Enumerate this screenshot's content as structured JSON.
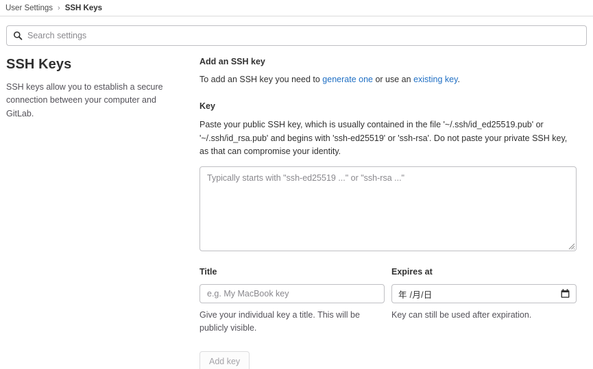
{
  "breadcrumb": {
    "parent": "User Settings",
    "separator": "›",
    "current": "SSH Keys"
  },
  "search": {
    "placeholder": "Search settings",
    "value": "",
    "icon": "search-icon"
  },
  "sidebar": {
    "title": "SSH Keys",
    "description": "SSH keys allow you to establish a secure connection between your computer and GitLab."
  },
  "main": {
    "section_title": "Add an SSH key",
    "intro": {
      "text_before": "To add an SSH key you need to ",
      "link_generate": "generate one",
      "text_middle": " or use an ",
      "link_existing": "existing key",
      "text_after": "."
    },
    "key": {
      "label": "Key",
      "description": "Paste your public SSH key, which is usually contained in the file '~/.ssh/id_ed25519.pub' or '~/.ssh/id_rsa.pub' and begins with 'ssh-ed25519' or 'ssh-rsa'. Do not paste your private SSH key, as that can compromise your identity.",
      "placeholder": "Typically starts with \"ssh-ed25519 ...\" or \"ssh-rsa ...\"",
      "value": ""
    },
    "title_field": {
      "label": "Title",
      "placeholder": "e.g. My MacBook key",
      "value": "",
      "help": "Give your individual key a title. This will be publicly visible."
    },
    "expires_field": {
      "label": "Expires at",
      "placeholder": "年 /月/日",
      "value": "",
      "help": "Key can still be used after expiration.",
      "icon": "calendar-icon"
    },
    "submit_label": "Add key"
  },
  "colors": {
    "link": "#1f6fc4",
    "text": "#303030",
    "muted": "#535158",
    "placeholder": "#89888d",
    "border": "#bfbfc3",
    "divider": "#dbdbdb"
  }
}
